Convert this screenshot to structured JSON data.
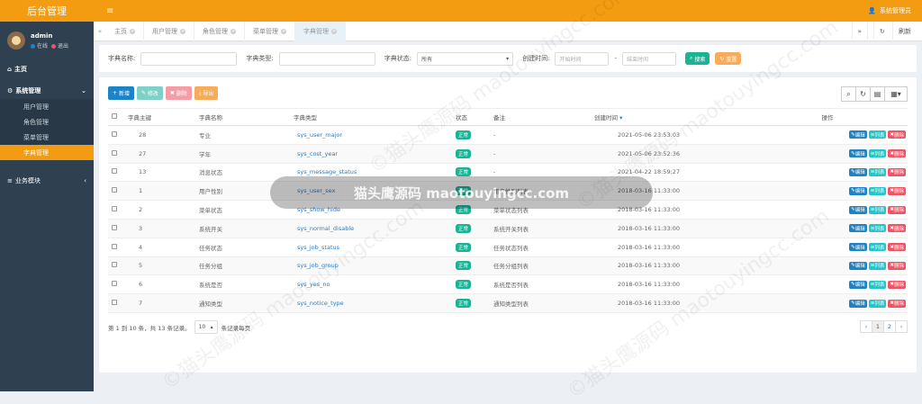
{
  "app": {
    "title": "后台管理",
    "admin": "系统管理员"
  },
  "user": {
    "name": "admin",
    "online": "在线",
    "logout": "退出"
  },
  "sidebar": {
    "home": "主页",
    "system": "系统管理",
    "items": [
      "用户管理",
      "角色管理",
      "菜单管理",
      "字典管理"
    ],
    "business": "业务模块"
  },
  "tabs": [
    "主页",
    "用户管理",
    "角色管理",
    "菜单管理",
    "字典管理"
  ],
  "refresh": "刷新",
  "search": {
    "name_label": "字典名称:",
    "type_label": "字典类型:",
    "status_label": "字典状态:",
    "status_value": "所有",
    "time_label": "创建时间:",
    "start_ph": "开始时间",
    "end_ph": "结束时间",
    "search_btn": "搜索",
    "reset_btn": "重置"
  },
  "toolbar": {
    "add": "新增",
    "edit": "修改",
    "del": "删除",
    "export": "导出"
  },
  "columns": [
    "字典主键",
    "字典名称",
    "字典类型",
    "状态",
    "备注",
    "创建时间",
    "操作"
  ],
  "rows": [
    {
      "id": "28",
      "name": "专业",
      "type": "sys_user_major",
      "status": "正常",
      "remark": "-",
      "time": "2021-05-06 23:53:03"
    },
    {
      "id": "27",
      "name": "学年",
      "type": "sys_cost_year",
      "status": "正常",
      "remark": "-",
      "time": "2021-05-06 23:52:36"
    },
    {
      "id": "13",
      "name": "消息状态",
      "type": "sys_message_status",
      "status": "正常",
      "remark": "-",
      "time": "2021-04-22 18:59:27"
    },
    {
      "id": "1",
      "name": "用户性别",
      "type": "sys_user_sex",
      "status": "正常",
      "remark": "用户性别列表",
      "time": "2018-03-16 11:33:00"
    },
    {
      "id": "2",
      "name": "菜单状态",
      "type": "sys_show_hide",
      "status": "正常",
      "remark": "菜单状态列表",
      "time": "2018-03-16 11:33:00"
    },
    {
      "id": "3",
      "name": "系统开关",
      "type": "sys_normal_disable",
      "status": "正常",
      "remark": "系统开关列表",
      "time": "2018-03-16 11:33:00"
    },
    {
      "id": "4",
      "name": "任务状态",
      "type": "sys_job_status",
      "status": "正常",
      "remark": "任务状态列表",
      "time": "2018-03-16 11:33:00"
    },
    {
      "id": "5",
      "name": "任务分组",
      "type": "sys_job_group",
      "status": "正常",
      "remark": "任务分组列表",
      "time": "2018-03-16 11:33:00"
    },
    {
      "id": "6",
      "name": "系统是否",
      "type": "sys_yes_no",
      "status": "正常",
      "remark": "系统是否列表",
      "time": "2018-03-16 11:33:00"
    },
    {
      "id": "7",
      "name": "通知类型",
      "type": "sys_notice_type",
      "status": "正常",
      "remark": "通知类型列表",
      "time": "2018-03-16 11:33:00"
    }
  ],
  "row_ops": {
    "edit": "编辑",
    "list": "列表",
    "del": "删除"
  },
  "pager": {
    "info": "第 1 到 10 条，共 13 条记录。",
    "size": "10",
    "per": "条记录每页",
    "pages": [
      "‹",
      "1",
      "2",
      "›"
    ]
  },
  "watermark": {
    "center": "猫头鹰源码 maotouyingcc.com",
    "text": "©猫头鹰源码 maotouyingcc.com"
  },
  "colors": {
    "orange": "#f39c12",
    "sidebar": "#2f4050",
    "green": "#1ab394",
    "blue": "#1c84c6",
    "red": "#ed5565",
    "teal": "#23c6c8"
  }
}
